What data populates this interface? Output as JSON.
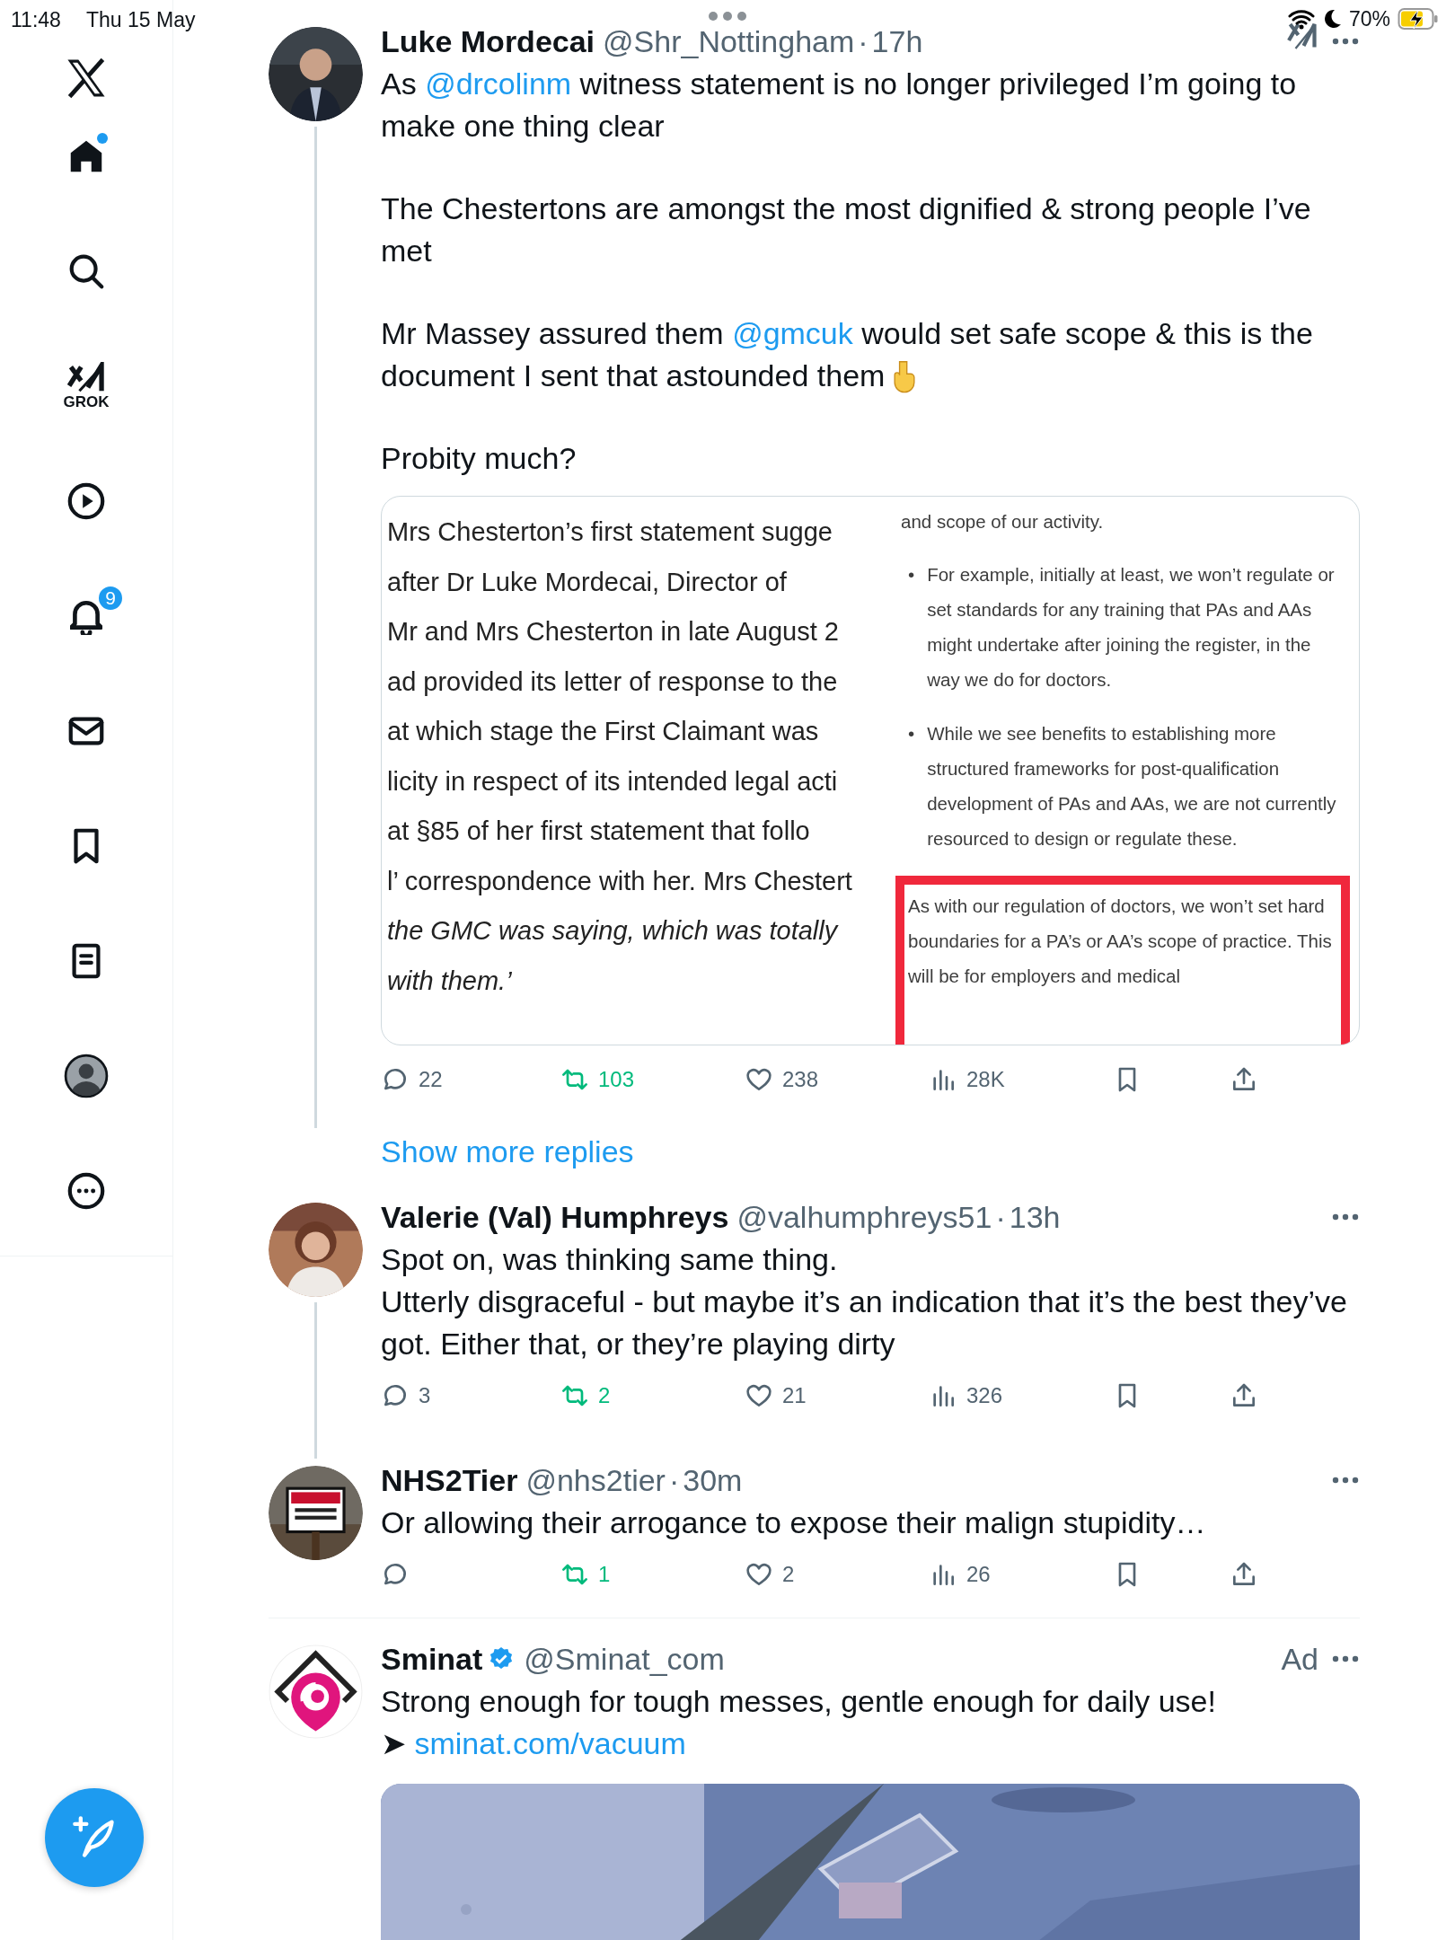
{
  "status_bar": {
    "time": "11:48",
    "date": "Thu 15 May",
    "battery": "70%",
    "charging": true
  },
  "sidebar": {
    "items": [
      {
        "kind": "home",
        "selected": true,
        "unread": true
      },
      {
        "kind": "search",
        "selected": false
      },
      {
        "kind": "grok",
        "selected": false,
        "label": "GROK"
      },
      {
        "kind": "video",
        "selected": false
      },
      {
        "kind": "notifications",
        "selected": false,
        "badge": "9"
      },
      {
        "kind": "messages",
        "selected": false
      },
      {
        "kind": "bookmarks",
        "selected": false
      },
      {
        "kind": "lists",
        "selected": false
      },
      {
        "kind": "profile",
        "selected": false
      },
      {
        "kind": "more",
        "selected": false
      }
    ]
  },
  "tweets": [
    {
      "author": "Luke Mordecai",
      "handle": "@Shr_Nottingham",
      "sep": "·",
      "time": "17h",
      "avatar": {
        "kind": "picture"
      },
      "thread": true,
      "grok": true,
      "paragraphs": [
        [
          {
            "text": "As "
          },
          {
            "text": "@drcolinm",
            "link": true
          },
          {
            "text": " witness statement is no longer privileged I’m going to make one thing clear"
          }
        ],
        [
          {
            "text": "The Chestertons are amongst the most dignified & strong people I’ve met"
          }
        ],
        [
          {
            "text": "Mr Massey assured them "
          },
          {
            "text": "@gmcuk",
            "link": true
          },
          {
            "text": " would set safe scope & this is the document I sent that astounded them"
          },
          {
            "kind": "icon"
          }
        ],
        [
          {
            "text": "Probity much?"
          }
        ]
      ],
      "media": {
        "kind": "document",
        "left_lines": [
          {
            "text": "Mrs Chesterton’s first statement sugge",
            "italic": false
          },
          {
            "text": "after Dr Luke Mordecai, Director of",
            "italic": false
          },
          {
            "text": "Mr and Mrs Chesterton in late August 2",
            "italic": false
          },
          {
            "text": "ad provided its letter of response to the",
            "italic": false
          },
          {
            "text": "at which stage the First Claimant was",
            "italic": false
          },
          {
            "text": "licity in respect of its intended legal acti",
            "italic": false
          },
          {
            "text": "at §85 of her first statement that follo",
            "italic": false
          },
          {
            "text": "l’ correspondence with her. Mrs Chestert",
            "italic": false
          },
          {
            "text": "the GMC was saying, which was totally",
            "italic": true
          },
          {
            "text": "with them.’",
            "italic": true
          }
        ],
        "right_intro": "and scope of our activity.",
        "bullets": [
          {
            "marker": "•",
            "text": "For example, initially at least, we won’t regulate or set standards for any training that PAs and AAs might undertake after joining the register, in the way we do for doctors."
          },
          {
            "marker": "•",
            "text": "While we see benefits to establishing more structured frameworks for post-qualification development of PAs and AAs, we are not currently resourced to design or regulate these."
          }
        ],
        "highlight": "As with our regulation of doctors, we won’t set hard boundaries for a PA’s or AA’s scope of practice. This will be for employers and medical"
      },
      "actions": {
        "replies": "22",
        "reposts": "103",
        "likes": "238",
        "views": "28K",
        "reposted": true
      },
      "show_more": "Show more replies"
    },
    {
      "author": "Valerie (Val) Humphreys",
      "handle": "@valhumphreys51",
      "sep": "·",
      "time": "13h",
      "avatar": {
        "kind": "picture"
      },
      "thread": true,
      "paragraphs": [
        [
          {
            "text": "Spot on, was thinking same thing."
          }
        ],
        [
          {
            "text": "Utterly disgraceful - but maybe it’s an indication that it’s the best they’ve got. Either that, or they’re playing dirty"
          }
        ]
      ],
      "actions": {
        "replies": "3",
        "reposts": "2",
        "likes": "21",
        "views": "326",
        "reposted": true
      }
    },
    {
      "author": "NHS2Tier",
      "handle": "@nhs2tier",
      "sep": "·",
      "time": "30m",
      "avatar": {
        "kind": "picture"
      },
      "thread": false,
      "paragraphs": [
        [
          {
            "text": "Or allowing their arrogance to expose their malign stupidity…"
          }
        ]
      ],
      "actions": {
        "reposts": "1",
        "likes": "2",
        "views": "26",
        "reposted": true
      }
    },
    {
      "author": "Sminat",
      "handle": "@Sminat_com",
      "avatar": {
        "kind": "logo"
      },
      "verified": true,
      "promoted_label": "Ad",
      "thread": false,
      "divider_before": true,
      "paragraphs": [
        [
          {
            "text": "Strong enough for tough messes, gentle enough for daily use!"
          }
        ],
        [
          {
            "text": "➤ "
          },
          {
            "text": "sminat.com/vacuum",
            "link": true
          }
        ]
      ],
      "media": {
        "kind": "picture"
      }
    }
  ]
}
